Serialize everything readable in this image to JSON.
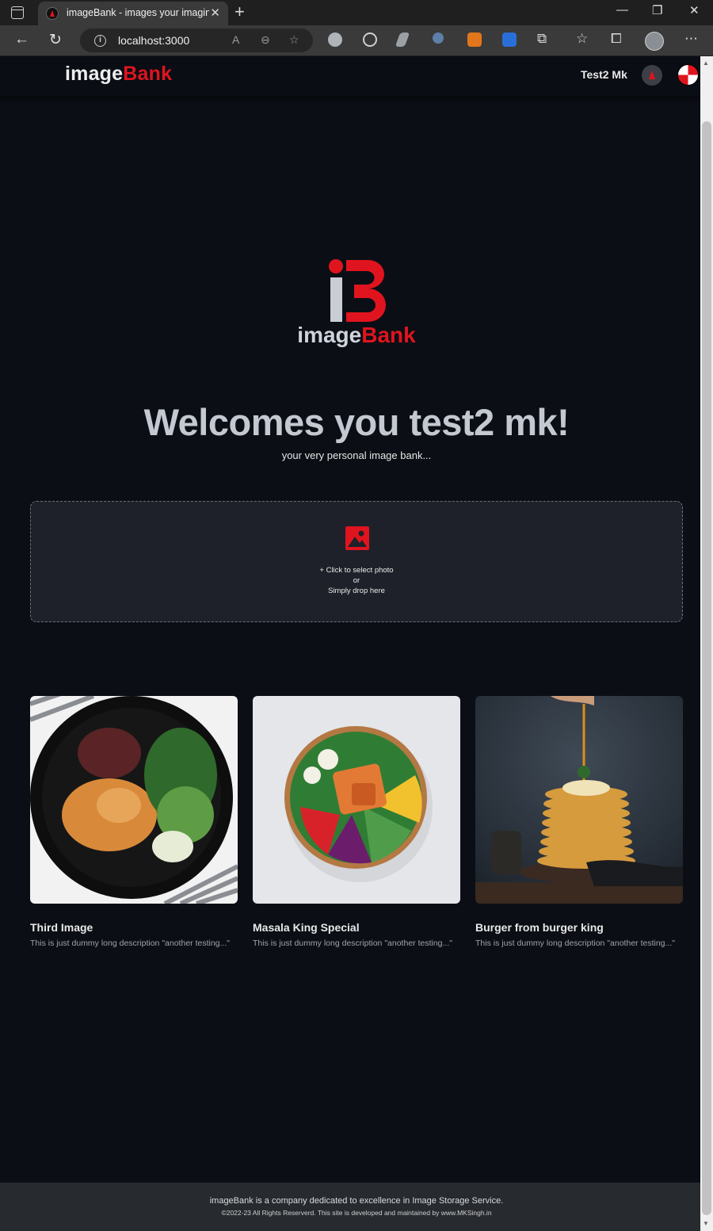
{
  "browser": {
    "tab_title": "imageBank - images your imagin",
    "url": "localhost:3000"
  },
  "navbar": {
    "brand_white": "image",
    "brand_red": "Bank",
    "username": "Test2 Mk"
  },
  "hero": {
    "brand_white": "image",
    "brand_red": "Bank",
    "welcome": "Welcomes you test2 mk!",
    "tagline": "your very personal image bank..."
  },
  "upload": {
    "line1": "+ Click to select photo",
    "line2": "or",
    "line3": "Simply drop here"
  },
  "cards": [
    {
      "title": "Third Image",
      "description": "This is just dummy long description \"another testing...\""
    },
    {
      "title": "Masala King Special",
      "description": "This is just dummy long description \"another testing...\""
    },
    {
      "title": "Burger from burger king",
      "description": "This is just dummy long description \"another testing...\""
    }
  ],
  "footer": {
    "line1": "imageBank is a company dedicated to excellence in Image Storage Service.",
    "line2": "©2022-23 All Rights Reserverd. This site is developed and maintained by www.MKSingh.in"
  },
  "colors": {
    "accent": "#e0141e",
    "background": "#0b0e15",
    "dropzone": "#1e2129",
    "footer": "#272a2f"
  }
}
